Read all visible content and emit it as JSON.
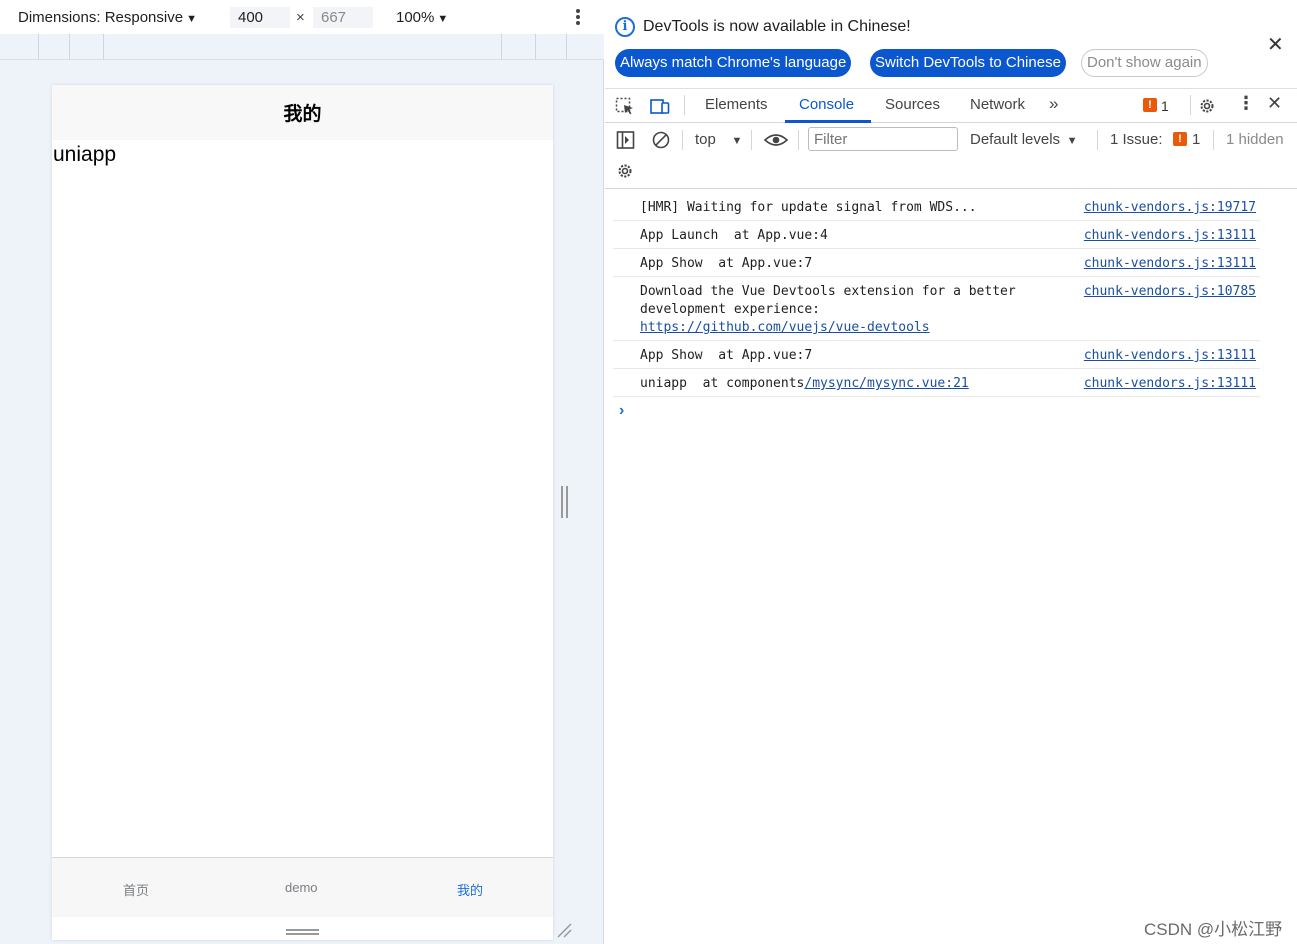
{
  "device_toolbar": {
    "dimensions_label": "Dimensions: Responsive",
    "width": "400",
    "times": "×",
    "height": "667",
    "zoom": "100%"
  },
  "device_page": {
    "nav_title": "我的",
    "content_text": "uniapp",
    "tabs": [
      {
        "label": "首页",
        "active": false
      },
      {
        "label": "demo",
        "active": false
      },
      {
        "label": "我的",
        "active": true
      }
    ]
  },
  "infobar": {
    "message": "DevTools is now available in Chinese!",
    "buttons": {
      "always_match": "Always match Chrome's language",
      "switch": "Switch DevTools to Chinese",
      "dont_show": "Don't show again"
    }
  },
  "devtools_tabs": {
    "elements": "Elements",
    "console": "Console",
    "sources": "Sources",
    "network": "Network",
    "issues_count": "1"
  },
  "console_toolbar": {
    "context": "top",
    "filter_placeholder": "Filter",
    "levels": "Default levels",
    "issues_label": "1 Issue:",
    "issues_count": "1",
    "hidden": "1 hidden"
  },
  "log": [
    {
      "message": "[HMR] Waiting for update signal from WDS...",
      "source": "chunk-vendors.js:19717"
    },
    {
      "message": "App Launch  at App.vue:4",
      "source": "chunk-vendors.js:13111"
    },
    {
      "message": "App Show  at App.vue:7",
      "source": "chunk-vendors.js:13111"
    },
    {
      "message": "Download the Vue Devtools extension for a better development experience:",
      "link": "https://github.com/vuejs/vue-devtools",
      "source": "chunk-vendors.js:10785"
    },
    {
      "message": "App Show  at App.vue:7",
      "source": "chunk-vendors.js:13111"
    },
    {
      "message": "uniapp  at components",
      "link": "/mysync/mysync.vue:21",
      "source": "chunk-vendors.js:13111"
    }
  ],
  "watermark": "CSDN @小松江野",
  "colors": {
    "accent": "#0b57d0",
    "tab_active": "#1a6fe0",
    "issue": "#e8590c"
  }
}
